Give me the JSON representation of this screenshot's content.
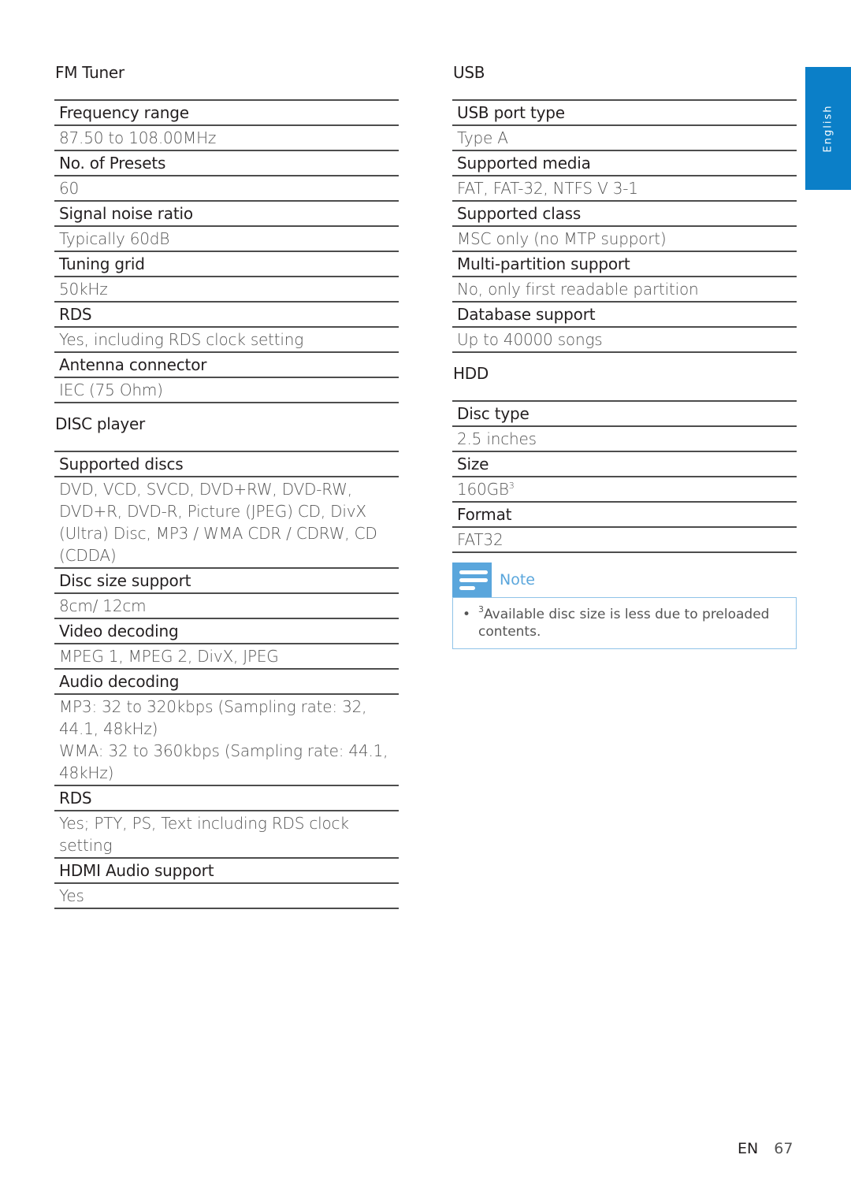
{
  "side_tab": {
    "label": "English"
  },
  "left_column": {
    "sections": [
      {
        "title": "FM Tuner",
        "rows": [
          {
            "label": "Frequency range",
            "value": [
              "87.50 to 108.00MHz"
            ]
          },
          {
            "label": "No. of Presets",
            "value": [
              "60"
            ]
          },
          {
            "label": "Signal noise ratio",
            "value": [
              "Typically 60dB"
            ]
          },
          {
            "label": "Tuning grid",
            "value": [
              "50kHz"
            ]
          },
          {
            "label": "RDS",
            "value": [
              "Yes, including RDS clock setting"
            ]
          },
          {
            "label": "Antenna connector",
            "value": [
              "IEC (75 Ohm)"
            ]
          }
        ]
      },
      {
        "title": "DISC player",
        "rows": [
          {
            "label": "Supported discs",
            "value": [
              "DVD, VCD, SVCD, DVD+RW, DVD-RW, DVD+R, DVD-R, Picture (JPEG) CD, DivX (Ultra) Disc, MP3 / WMA CDR / CDRW, CD (CDDA)"
            ]
          },
          {
            "label": "Disc size support",
            "value": [
              "8cm/ 12cm"
            ]
          },
          {
            "label": "Video decoding",
            "value": [
              "MPEG 1, MPEG 2, DivX, JPEG"
            ]
          },
          {
            "label": "Audio decoding",
            "value": [
              "MP3: 32 to 320kbps (Sampling rate: 32, 44.1, 48kHz)",
              "WMA: 32 to 360kbps (Sampling rate: 44.1, 48kHz)"
            ]
          },
          {
            "label": "RDS",
            "value": [
              "Yes; PTY, PS, Text including RDS clock setting"
            ]
          },
          {
            "label": "HDMI Audio support",
            "value": [
              "Yes"
            ]
          }
        ]
      }
    ]
  },
  "right_column": {
    "sections": [
      {
        "title": "USB",
        "rows": [
          {
            "label": "USB port type",
            "value": [
              "Type A"
            ]
          },
          {
            "label": "Supported media",
            "value": [
              "FAT, FAT-32, NTFS V 3-1"
            ]
          },
          {
            "label": "Supported class",
            "value": [
              "MSC only (no MTP support)"
            ]
          },
          {
            "label": "Multi-partition support",
            "value": [
              "No, only first readable partition"
            ]
          },
          {
            "label": "Database support",
            "value": [
              "Up to 40000 songs"
            ]
          }
        ]
      },
      {
        "title": "HDD",
        "rows": [
          {
            "label": "Disc type",
            "value": [
              "2.5 inches"
            ]
          },
          {
            "label": "Size",
            "value": [
              "160GB"
            ],
            "sup": "3"
          },
          {
            "label": "Format",
            "value": [
              "FAT32"
            ]
          }
        ]
      }
    ],
    "note": {
      "label": "Note",
      "icon": "note-icon",
      "bullet": "•",
      "sup": "3",
      "text": "Available disc size is less due to preloaded contents."
    }
  },
  "footer": {
    "language": "EN",
    "page_number": "67"
  },
  "colors": {
    "accent": "#0b7fc8",
    "note_blue": "#5aa6dc",
    "rule": "#4d4d4d"
  }
}
